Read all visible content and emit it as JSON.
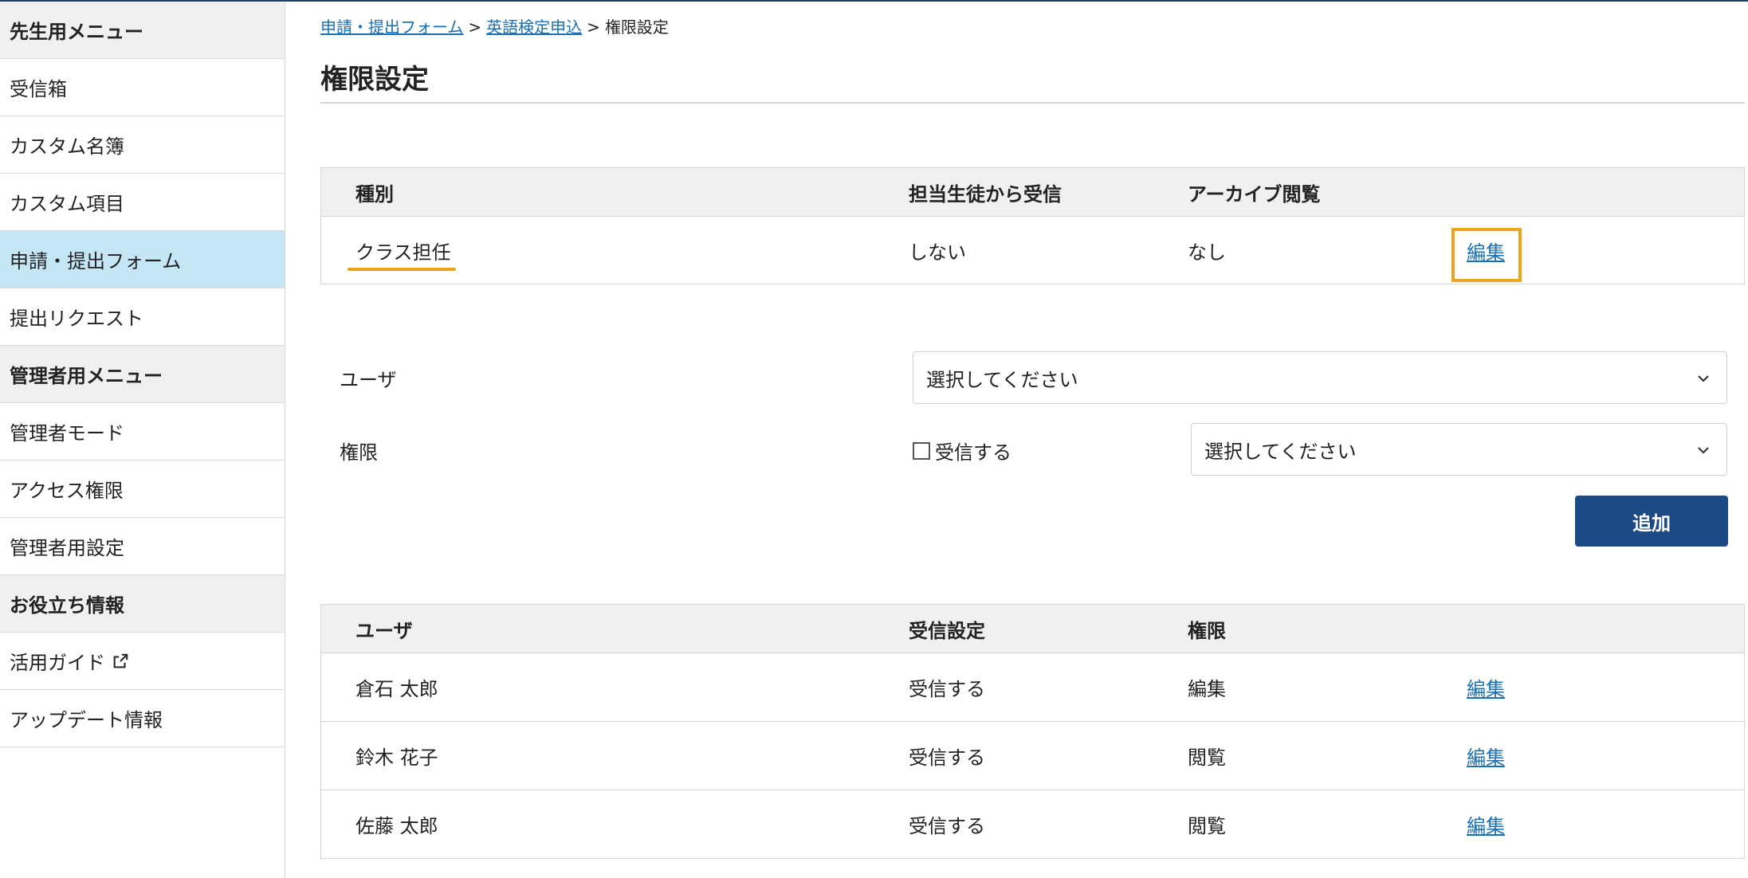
{
  "sidebar": {
    "items": [
      {
        "label": "先生用メニュー",
        "type": "section"
      },
      {
        "label": "受信箱",
        "type": "item"
      },
      {
        "label": "カスタム名簿",
        "type": "item"
      },
      {
        "label": "カスタム項目",
        "type": "item"
      },
      {
        "label": "申請・提出フォーム",
        "type": "item",
        "active": true
      },
      {
        "label": "提出リクエスト",
        "type": "item"
      },
      {
        "label": "管理者用メニュー",
        "type": "section"
      },
      {
        "label": "管理者モード",
        "type": "item"
      },
      {
        "label": "アクセス権限",
        "type": "item"
      },
      {
        "label": "管理者用設定",
        "type": "item"
      },
      {
        "label": "お役立ち情報",
        "type": "section"
      },
      {
        "label": "活用ガイド",
        "type": "item",
        "icon": "external-link-icon"
      },
      {
        "label": "アップデート情報",
        "type": "item"
      }
    ]
  },
  "breadcrumb": {
    "items": [
      "申請・提出フォーム",
      "英語検定申込",
      "権限設定"
    ],
    "separator": ">"
  },
  "page": {
    "title": "権限設定"
  },
  "role_table": {
    "headers": [
      "種別",
      "担当生徒から受信",
      "アーカイブ閲覧",
      ""
    ],
    "rows": [
      {
        "type": "クラス担任",
        "receive": "しない",
        "archive": "なし",
        "action": "編集"
      }
    ]
  },
  "form": {
    "user_label": "ユーザ",
    "user_select": "選択してください",
    "permission_label": "権限",
    "receive_checkbox_label": "受信する",
    "receive_checked": false,
    "permission_select": "選択してください",
    "add_button": "追加"
  },
  "user_table": {
    "headers": [
      "ユーザ",
      "受信設定",
      "権限",
      ""
    ],
    "rows": [
      {
        "user": "倉石 太郎",
        "receive": "受信する",
        "permission": "編集",
        "action": "編集"
      },
      {
        "user": "鈴木 花子",
        "receive": "受信する",
        "permission": "閲覧",
        "action": "編集"
      },
      {
        "user": "佐藤 太郎",
        "receive": "受信する",
        "permission": "閲覧",
        "action": "編集"
      }
    ]
  },
  "colors": {
    "accent": "#1b4a85",
    "link": "#1a6fb5",
    "active_nav": "#c5e6f5",
    "highlight": "#f0a31c"
  }
}
